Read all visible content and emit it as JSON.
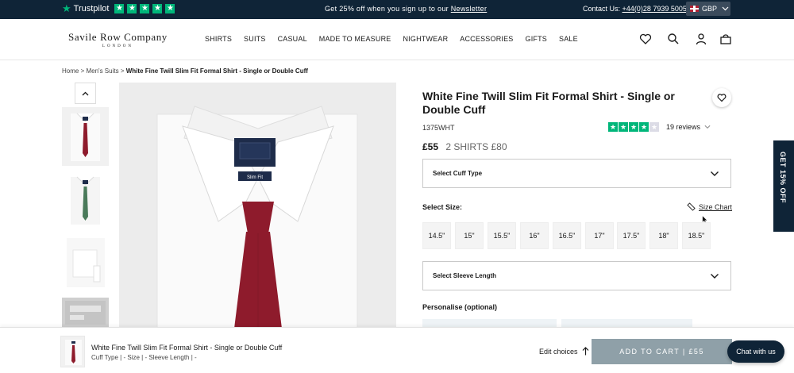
{
  "topbar": {
    "trustpilot_label": "Trustpilot",
    "trustpilot_stars": 5,
    "promo_text": "Get 25% off when you sign up to our",
    "promo_link": "Newsletter",
    "contact_label": "Contact Us:",
    "contact_phone": "+44(0)28 7939 5005",
    "currency": "GBP"
  },
  "header": {
    "logo_main": "Savile Row Company",
    "logo_sub": "LONDON",
    "nav": [
      "SHIRTS",
      "SUITS",
      "CASUAL",
      "MADE TO MEASURE",
      "NIGHTWEAR",
      "ACCESSORIES",
      "GIFTS",
      "SALE"
    ],
    "icons": [
      "heart-icon",
      "search-icon",
      "account-icon",
      "bag-icon"
    ]
  },
  "breadcrumb": {
    "items": [
      "Home",
      "Men's Suits"
    ],
    "current": "White Fine Twill Slim Fit Formal Shirt - Single or Double Cuff",
    "separator": ">"
  },
  "gallery": {
    "label_fit": "Slim Fit"
  },
  "product": {
    "title": "White Fine Twill Slim Fit Formal Shirt - Single or Double Cuff",
    "sku": "1375WHT",
    "rating": 4,
    "rating_max": 5,
    "reviews": "19 reviews",
    "price": "£55",
    "deal": "2 SHIRTS £80",
    "cuff_placeholder": "Select Cuff Type",
    "size_label": "Select Size:",
    "size_chart": "Size Chart",
    "sizes": [
      "14.5\"",
      "15\"",
      "15.5\"",
      "16\"",
      "16.5\"",
      "17\"",
      "17.5\"",
      "18\"",
      "18.5\""
    ],
    "sleeve_placeholder": "Select Sleeve Length",
    "personalise_label": "Personalise (optional)"
  },
  "sidetab": {
    "label": "GET 15% OFF"
  },
  "sticky": {
    "title": "White Fine Twill Slim Fit Formal Shirt - Single or Double Cuff",
    "meta": "Cuff Type | -    Size | -    Sleeve Length | -",
    "edit": "Edit choices",
    "atc": "ADD TO CART | £55",
    "chat": "Chat with us"
  },
  "colors": {
    "navy": "#0f2437",
    "trustpilot_green": "#00b67a",
    "tie_red": "#8e1b2c",
    "tie_green": "#4a7a5a",
    "atc_bg": "#8fa0a8"
  }
}
